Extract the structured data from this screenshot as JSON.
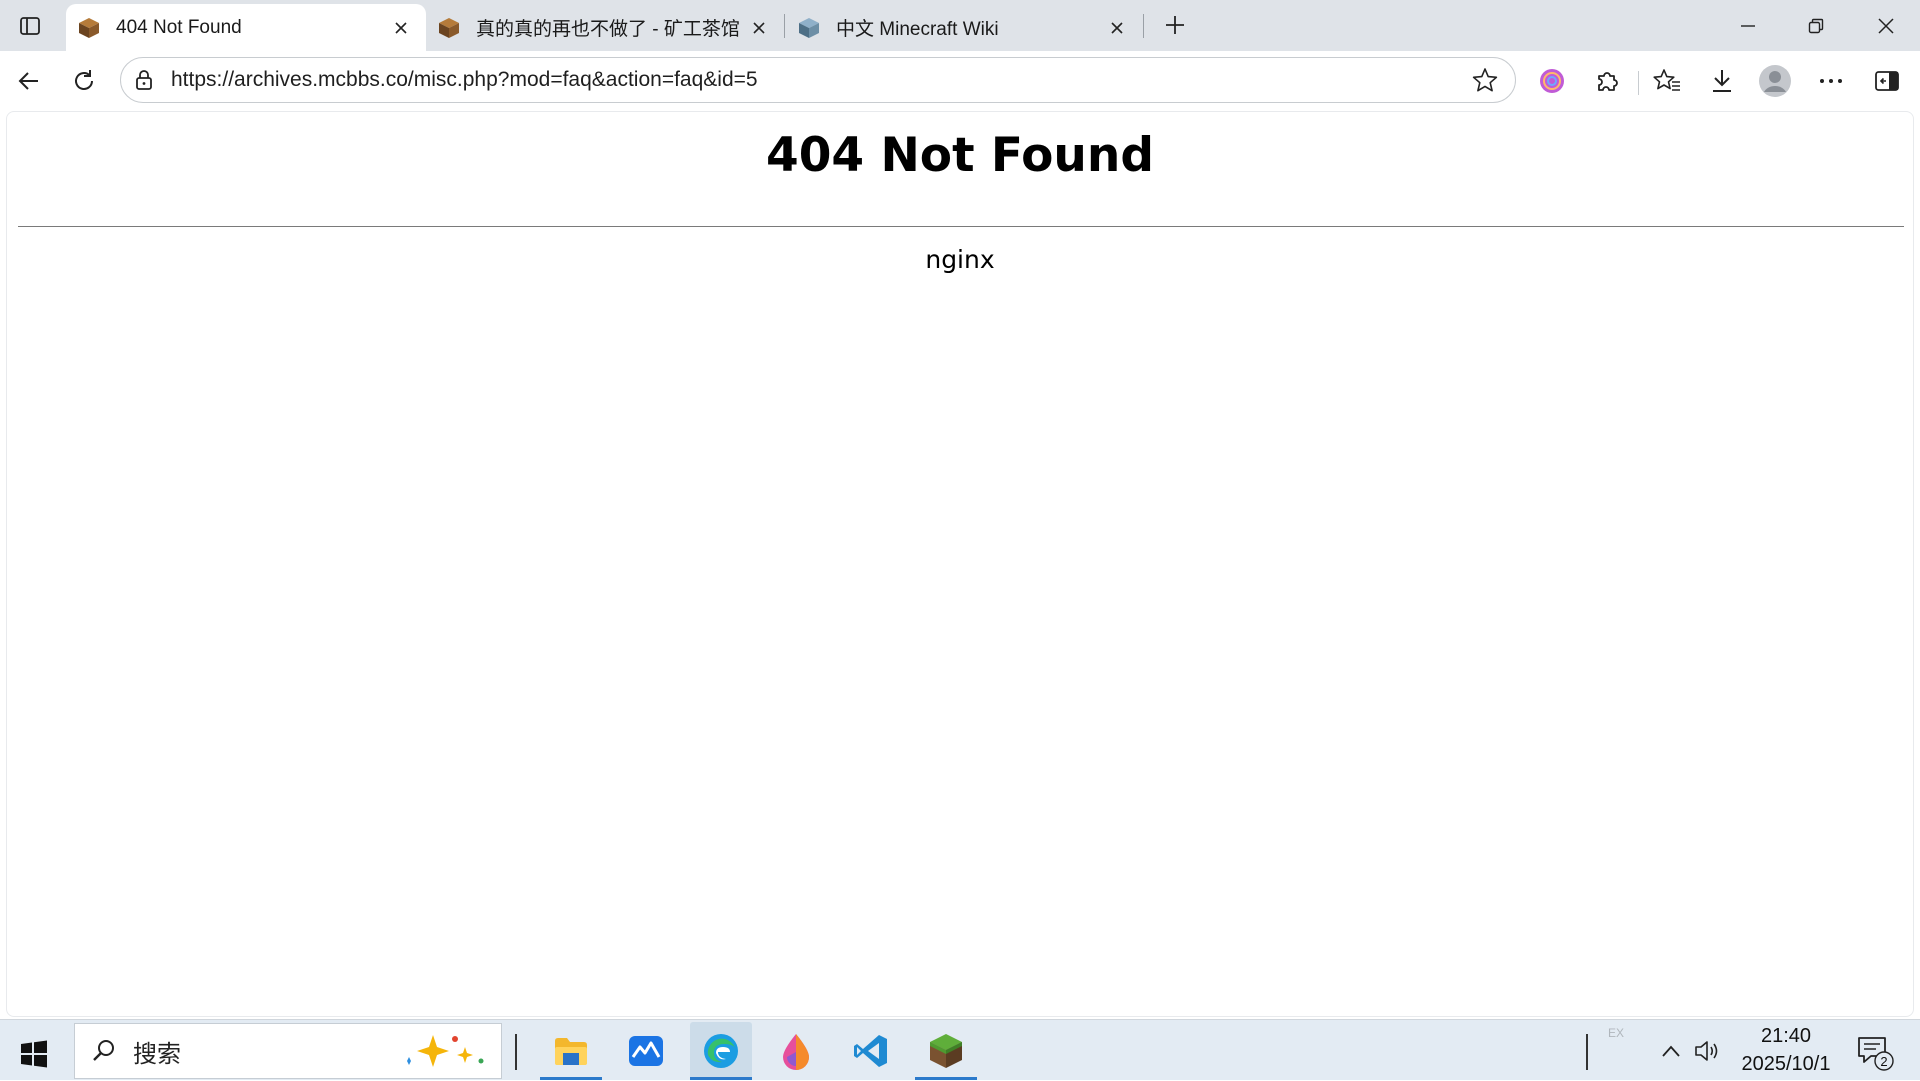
{
  "browser": {
    "tabs": [
      {
        "label": "404 Not Found",
        "active": true
      },
      {
        "label": "真的真的再也不做了 - 矿工茶馆 -",
        "active": false
      },
      {
        "label": "中文 Minecraft Wiki",
        "active": false
      }
    ],
    "address_bar": {
      "url": "https://archives.mcbbs.co/misc.php?mod=faq&action=faq&id=5"
    }
  },
  "page": {
    "heading": "404 Not Found",
    "server": "nginx"
  },
  "taskbar": {
    "search_placeholder": "搜索",
    "ime_indicator": "EX",
    "clock": {
      "time": "21:40",
      "date": "2025/10/1"
    },
    "notification_count": "2"
  },
  "colors": {
    "titlebar_bg": "#dfe3e8",
    "taskbar_bg": "#e3ebf3",
    "accent": "#2c7acb"
  }
}
